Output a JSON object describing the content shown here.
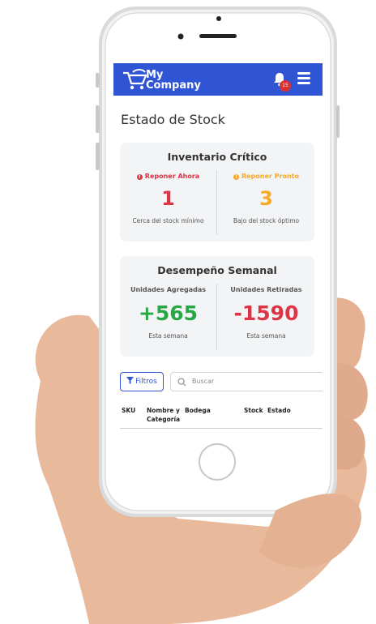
{
  "app": {
    "brand_line1": "My",
    "brand_line2": "Company",
    "notification_count": "15"
  },
  "page": {
    "title": "Estado de Stock"
  },
  "critical_inventory": {
    "title": "Inventario Crítico",
    "left": {
      "label": "Reponer Ahora",
      "value": "1",
      "caption": "Cerca del stock mínimo",
      "color": "#dc3545"
    },
    "right": {
      "label": "Reponer Pronto",
      "value": "3",
      "caption": "Bajo del stock óptimo",
      "color": "#f7a928"
    }
  },
  "weekly_performance": {
    "title": "Desempeño Semanal",
    "left": {
      "label": "Unidades Agregadas",
      "value": "+565",
      "caption": "Esta semana",
      "color": "#28a745"
    },
    "right": {
      "label": "Unidades Retiradas",
      "value": "-1590",
      "caption": "Esta semana",
      "color": "#dc3545"
    }
  },
  "toolbar": {
    "filter_label": "Filtros",
    "search_placeholder": "Buscar"
  },
  "table": {
    "columns": [
      "SKU",
      "Nombre y",
      "Categoría",
      "Bodega",
      "Stock",
      "Estado"
    ]
  },
  "colors": {
    "accent": "#2f55d4",
    "card_bg": "#f3f4f6"
  }
}
